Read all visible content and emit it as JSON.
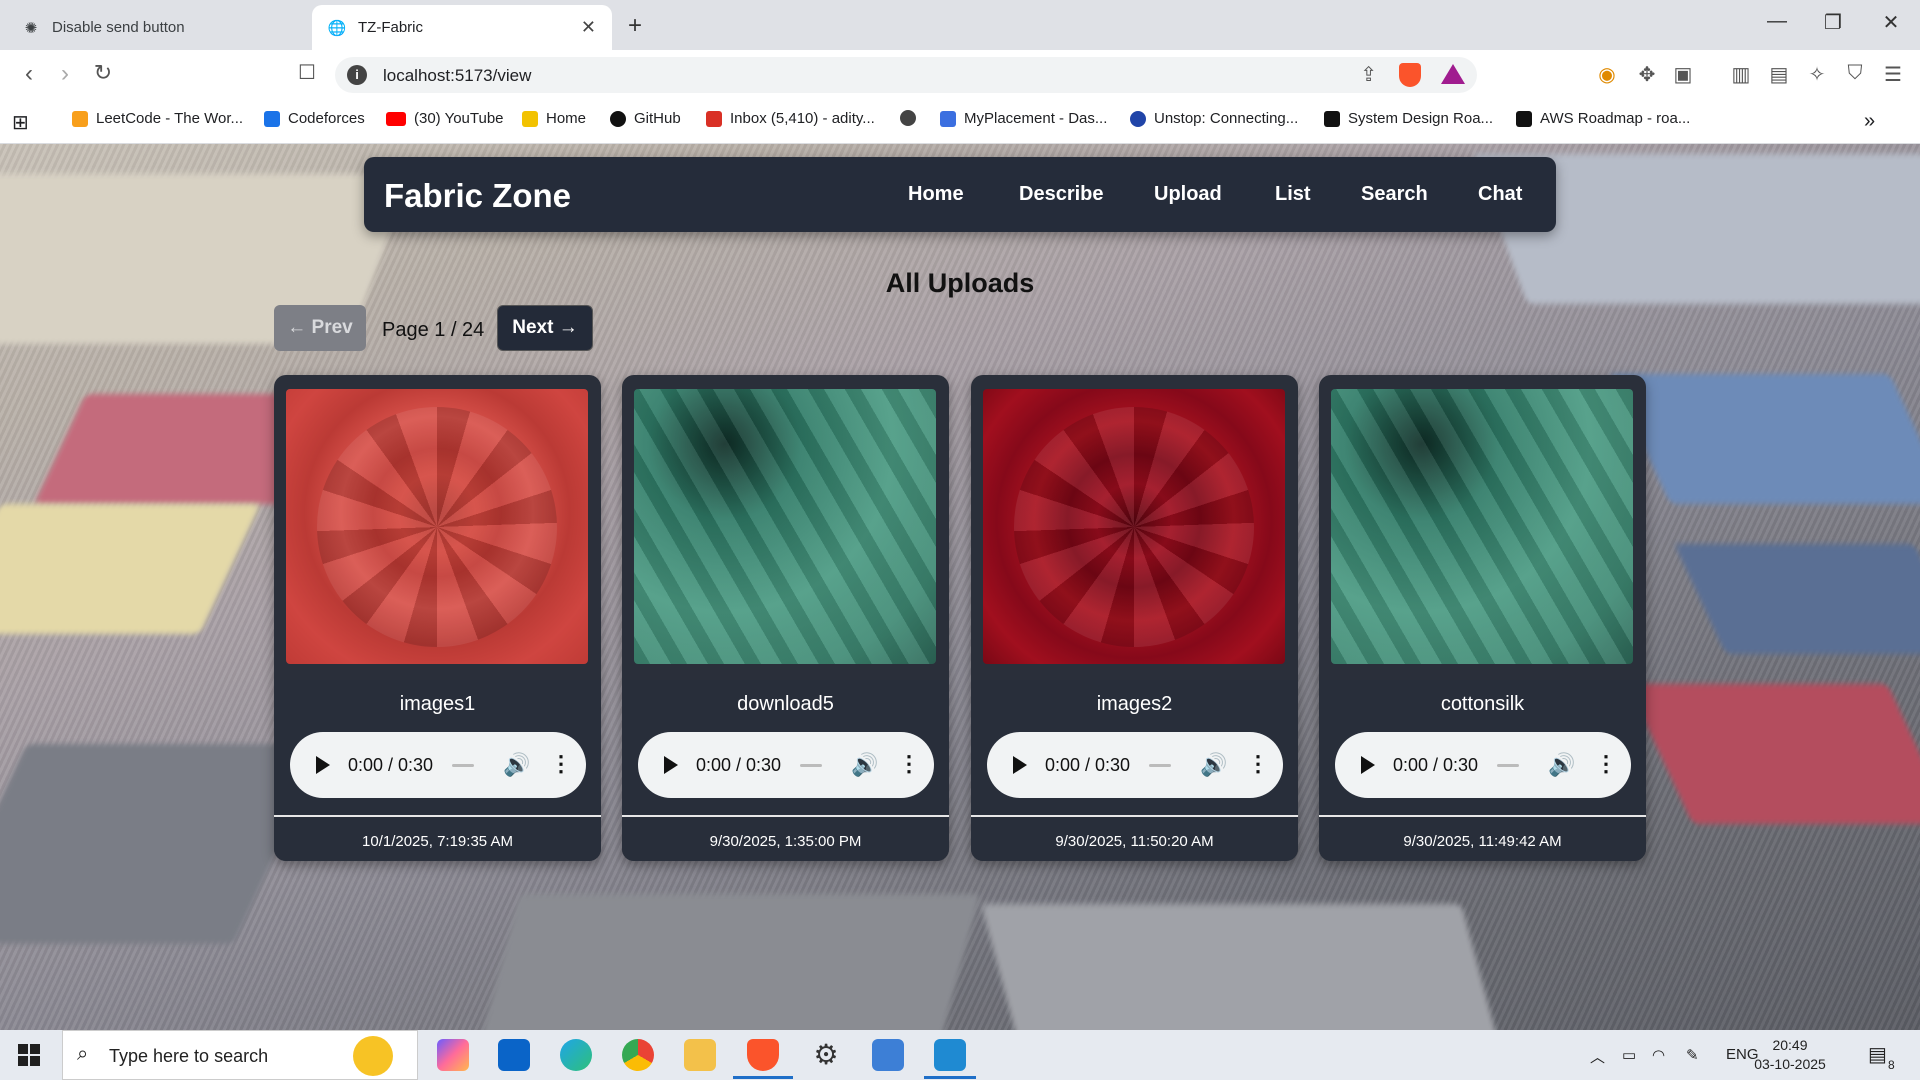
{
  "browser": {
    "tabs": [
      {
        "title": "Disable send button",
        "active": false
      },
      {
        "title": "TZ-Fabric",
        "active": true
      }
    ],
    "url": "localhost:5173/view",
    "bookmarks": [
      {
        "label": "LeetCode - The Wor...",
        "color": "#f89f1b"
      },
      {
        "label": "Codeforces",
        "color": "#1a73e8"
      },
      {
        "label": "(30) YouTube",
        "color": "#ff0000"
      },
      {
        "label": "Home",
        "color": "#f2c200"
      },
      {
        "label": "GitHub",
        "color": "#111111"
      },
      {
        "label": "Inbox (5,410) - adity...",
        "color": "#d93025"
      },
      {
        "label": "",
        "color": "#444444"
      },
      {
        "label": "MyPlacement - Das...",
        "color": "#3b6fe0"
      },
      {
        "label": "Unstop: Connecting...",
        "color": "#2044a8"
      },
      {
        "label": "System Design Roa...",
        "color": "#111111"
      },
      {
        "label": "AWS Roadmap - roa...",
        "color": "#111111"
      }
    ]
  },
  "app": {
    "brand": "Fabric Zone",
    "nav": [
      "Home",
      "Describe",
      "Upload",
      "List",
      "Search",
      "Chat"
    ],
    "page_title": "All Uploads",
    "pagination": {
      "prev_label": "← Prev",
      "next_label": "Next →",
      "indicator": "Page 1 / 24"
    },
    "cards": [
      {
        "name": "images1",
        "time": "0:00 / 0:30",
        "date": "10/1/2025, 7:19:35 AM",
        "fabric": "red"
      },
      {
        "name": "download5",
        "time": "0:00 / 0:30",
        "date": "9/30/2025, 1:35:00 PM",
        "fabric": "green"
      },
      {
        "name": "images2",
        "time": "0:00 / 0:30",
        "date": "9/30/2025, 11:50:20 AM",
        "fabric": "crimson"
      },
      {
        "name": "cottonsilk",
        "time": "0:00 / 0:30",
        "date": "9/30/2025, 11:49:42 AM",
        "fabric": "green"
      }
    ]
  },
  "taskbar": {
    "search_placeholder": "Type here to search",
    "language": "ENG",
    "time": "20:49",
    "date": "03-10-2025",
    "notification_count": "8"
  }
}
